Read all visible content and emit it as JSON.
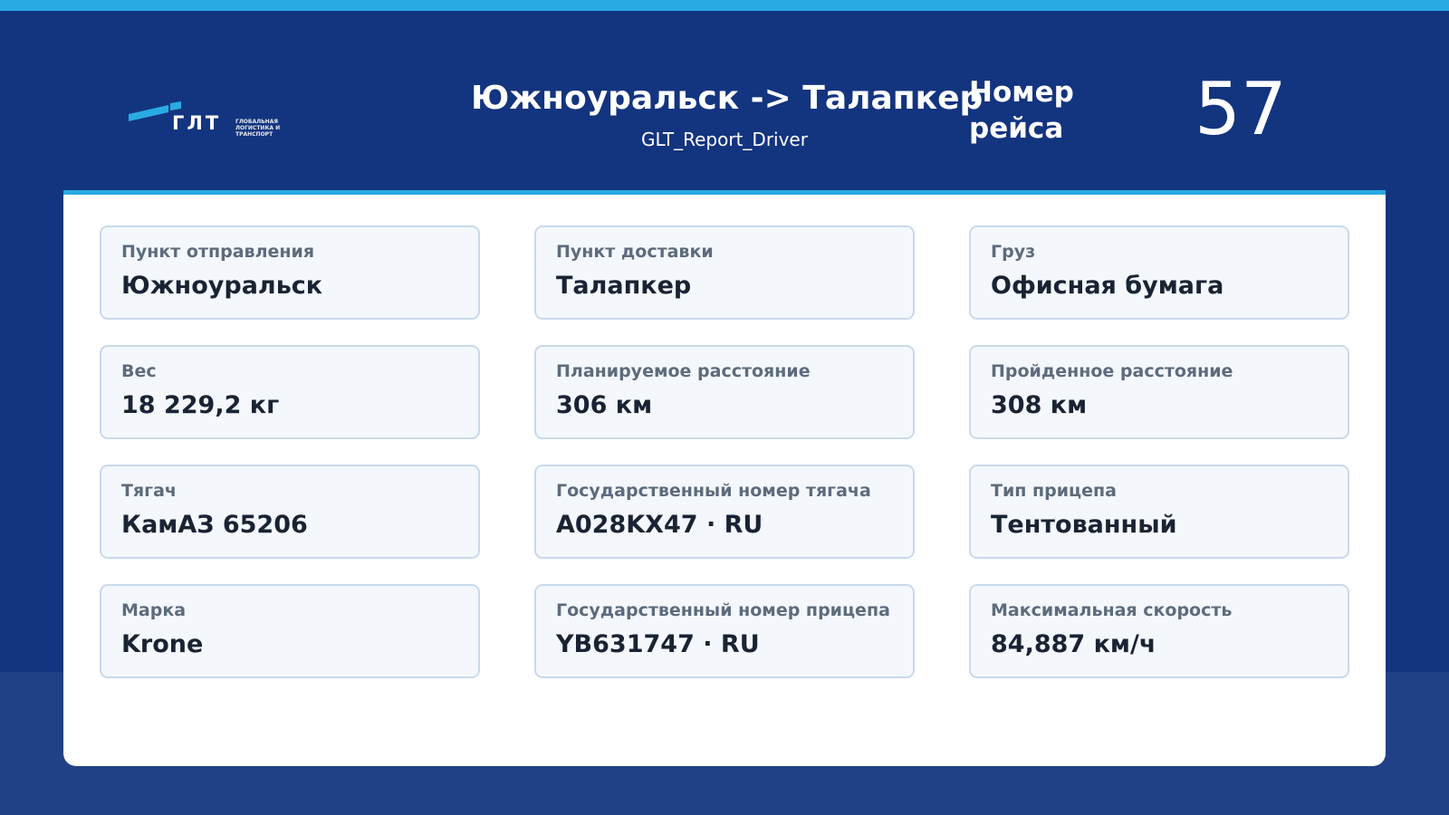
{
  "header": {
    "logo": {
      "text": "ГЛТ",
      "subtitle": "ГЛОБАЛЬНАЯ ЛОГИСТИКА И ТРАНСПОРТ",
      "accent": "#29abe2"
    },
    "route_title": "Южноуральск -> Талапкер",
    "report_name": "GLT_Report_Driver",
    "trip_label": "Номер рейса",
    "trip_number": "57"
  },
  "colors": {
    "background": "#13347f",
    "accent": "#29abe2",
    "card_background": "#f4f8fd",
    "card_border": "#c9d9ea"
  },
  "cards": [
    {
      "label": "Пункт отправления",
      "value": "Южноуральск"
    },
    {
      "label": "Пункт доставки",
      "value": "Талапкер"
    },
    {
      "label": "Груз",
      "value": "Офисная бумага"
    },
    {
      "label": "Вес",
      "value": "18 229,2 кг"
    },
    {
      "label": "Планируемое расстояние",
      "value": "306 км"
    },
    {
      "label": "Пройденное расстояние",
      "value": "308 км"
    },
    {
      "label": "Тягач",
      "value": "КамАЗ 65206"
    },
    {
      "label": "Государственный номер тягача",
      "value": "A028KX47 · RU"
    },
    {
      "label": "Тип прицепа",
      "value": "Тентованный"
    },
    {
      "label": "Марка",
      "value": "Krone"
    },
    {
      "label": "Государственный номер прицепа",
      "value": "YB631747 · RU"
    },
    {
      "label": "Максимальная скорость",
      "value": "84,887 км/ч"
    }
  ]
}
